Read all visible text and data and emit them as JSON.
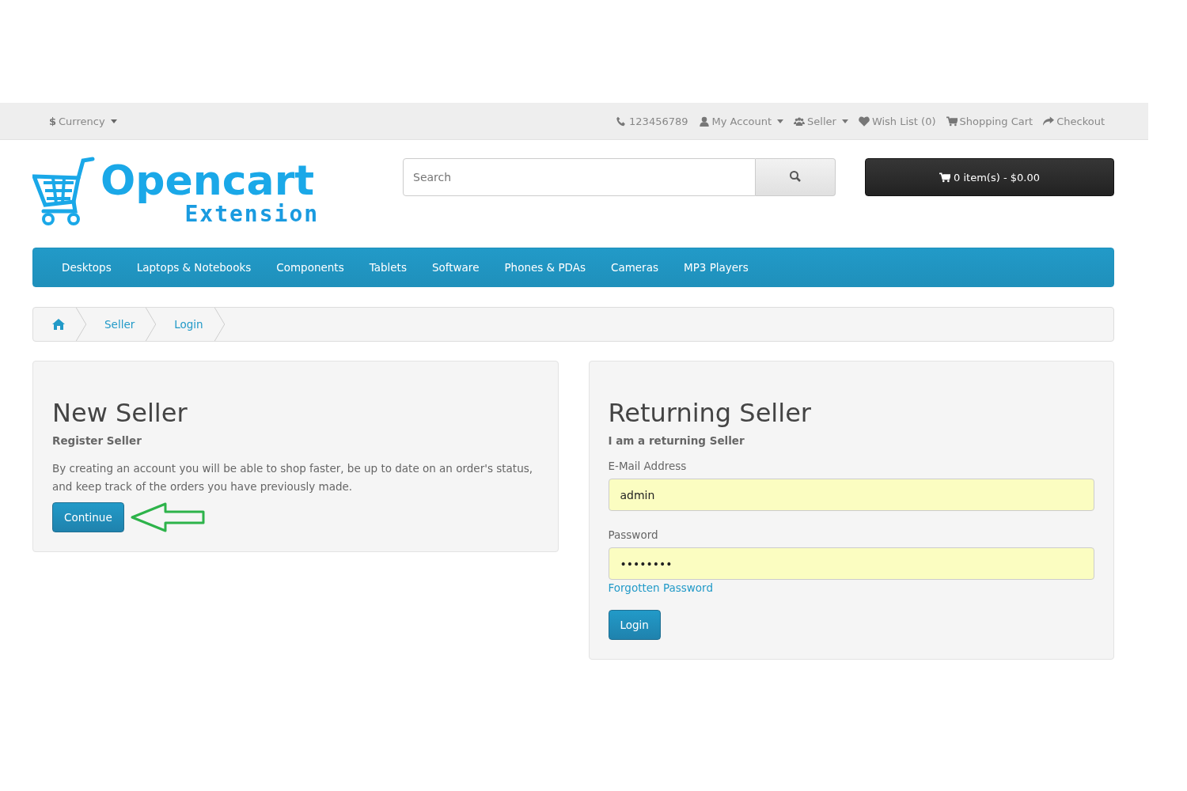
{
  "top_bar": {
    "currency": {
      "symbol": "$",
      "label": "Currency"
    },
    "links": [
      {
        "label": "123456789",
        "dropdown": false
      },
      {
        "label": "My Account",
        "dropdown": true
      },
      {
        "label": "Seller",
        "dropdown": true
      },
      {
        "label": "Wish List (0)",
        "dropdown": false
      },
      {
        "label": "Shopping Cart",
        "dropdown": false
      },
      {
        "label": "Checkout",
        "dropdown": false
      }
    ]
  },
  "logo": {
    "line_1": "Opencart",
    "line_2": "Extension"
  },
  "search": {
    "placeholder": "Search"
  },
  "cart_button": {
    "label": "0 item(s) - $0.00"
  },
  "menu": [
    "Desktops",
    "Laptops & Notebooks",
    "Components",
    "Tablets",
    "Software",
    "Phones & PDAs",
    "Cameras",
    "MP3 Players"
  ],
  "breadcrumb": [
    "Seller",
    "Login"
  ],
  "new_seller": {
    "title": "New Seller",
    "subtitle": "Register Seller",
    "text": "By creating an account you will be able to shop faster, be up to date on an order's status, and keep track of the orders you have previously made.",
    "button": "Continue"
  },
  "returning_seller": {
    "title": "Returning Seller",
    "subtitle": "I am a returning Seller",
    "email_label": "E-Mail Address",
    "email_value": "admin",
    "password_label": "Password",
    "password_value": "••••••••",
    "forgot_link": "Forgotten Password",
    "button": "Login"
  }
}
